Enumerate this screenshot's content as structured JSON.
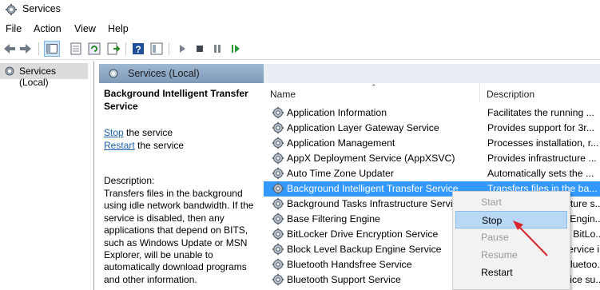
{
  "window": {
    "title": "Services",
    "icon": "services-gear-icon"
  },
  "menu": [
    "File",
    "Action",
    "View",
    "Help"
  ],
  "toolbar": {
    "buttons": [
      "back-arrow-icon",
      "forward-arrow-icon",
      "show-hide-tree-icon",
      "properties-icon",
      "refresh-icon",
      "export-list-icon",
      "help-icon",
      "console-tree-icon",
      "start-service-icon",
      "stop-service-icon",
      "pause-service-icon",
      "resume-service-icon"
    ]
  },
  "tree": {
    "root_label": "Services (Local)"
  },
  "pane": {
    "header": "Services (Local)"
  },
  "extended": {
    "title": "Background Intelligent Transfer Service",
    "stop_link": "Stop",
    "stop_suffix": " the service",
    "restart_link": "Restart",
    "restart_suffix": " the service",
    "desc_label": "Description:",
    "desc_text": "Transfers files in the background using idle network bandwidth. If the service is disabled, then any applications that depend on BITS, such as Windows Update or MSN Explorer, will be unable to automatically download programs and other information."
  },
  "list": {
    "columns": {
      "name": "Name",
      "description": "Description"
    },
    "rows": [
      {
        "name": "Application Information",
        "description": "Facilitates the running ..."
      },
      {
        "name": "Application Layer Gateway Service",
        "description": "Provides support for 3r..."
      },
      {
        "name": "Application Management",
        "description": "Processes installation, r..."
      },
      {
        "name": "AppX Deployment Service (AppXSVC)",
        "description": "Provides infrastructure ..."
      },
      {
        "name": "Auto Time Zone Updater",
        "description": "Automatically sets the ..."
      },
      {
        "name": "Background Intelligent Transfer Service",
        "description": "Transfers files in the ba...",
        "selected": true
      },
      {
        "name": "Background Tasks Infrastructure Service",
        "description": "Windows infrastructure s..."
      },
      {
        "name": "Base Filtering Engine",
        "description": "The Base Filtering Engin..."
      },
      {
        "name": "BitLocker Drive Encryption Service",
        "description": "BDESVC hosts the BitLo..."
      },
      {
        "name": "Block Level Backup Engine Service",
        "description": "The WBENGINE service i..."
      },
      {
        "name": "Bluetooth Handsfree Service",
        "description": "Enables wireless Bluetoo..."
      },
      {
        "name": "Bluetooth Support Service",
        "description": "The Bluetooth service su..."
      }
    ]
  },
  "context_menu": {
    "items": [
      {
        "label": "Start",
        "disabled": true
      },
      {
        "label": "Stop",
        "highlighted": true
      },
      {
        "label": "Pause",
        "disabled": true
      },
      {
        "label": "Resume",
        "disabled": true
      },
      {
        "label": "Restart"
      }
    ]
  },
  "colors": {
    "selection": "#3399ff",
    "link": "#1a5fb4",
    "annotation_arrow": "#d9262c"
  }
}
